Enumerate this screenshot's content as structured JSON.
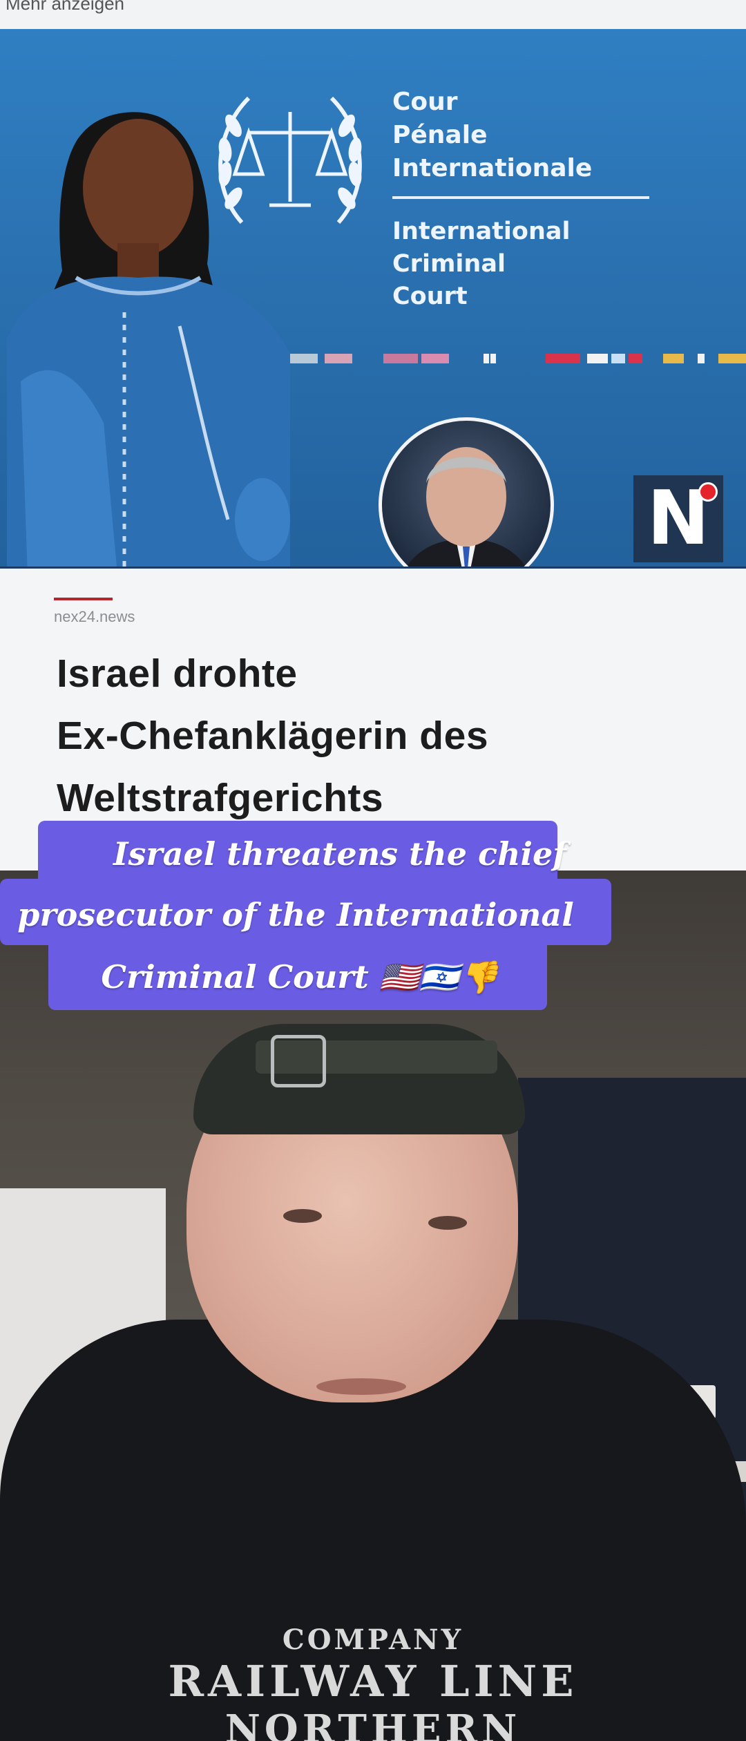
{
  "browser": {
    "top_link": "Mehr anzeigen"
  },
  "hero": {
    "court_fr": [
      "Cour",
      "Pénale",
      "Internationale"
    ],
    "court_en": [
      "International",
      "Criminal",
      "Court"
    ],
    "logo_letter": "N"
  },
  "article": {
    "source": "nex24.news",
    "headline_lines": [
      "Israel drohte",
      "Ex-Chefanklägerin des",
      "Weltstrafgerichts"
    ]
  },
  "caption": {
    "lines": [
      "Israel threatens the chief",
      "prosecutor of the International",
      "Criminal Court 🇺🇸🇮🇱👎"
    ]
  },
  "shirt": {
    "lines": [
      "COMPANY",
      "RAILWAY LINE",
      "NORTHERN"
    ]
  }
}
